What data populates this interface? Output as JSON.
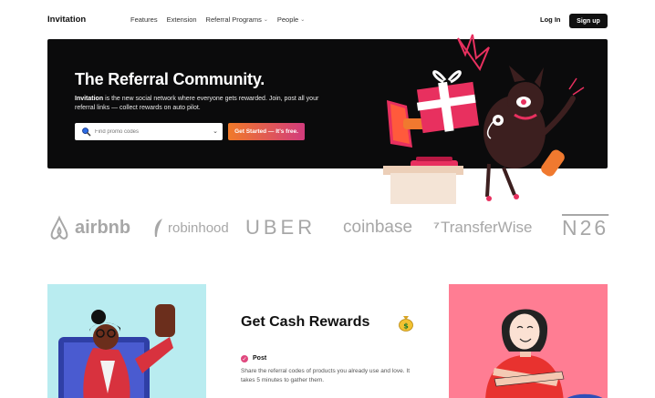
{
  "nav": {
    "brand": "Invitation",
    "links": [
      {
        "label": "Features",
        "dropdown": false
      },
      {
        "label": "Extension",
        "dropdown": false
      },
      {
        "label": "Referral Programs",
        "dropdown": true
      },
      {
        "label": "People",
        "dropdown": true
      }
    ],
    "login": "Log In",
    "signup": "Sign up"
  },
  "hero": {
    "title": "The Referral Community.",
    "desc_bold": "Invitation",
    "desc_rest": " is the new social network where everyone gets rewarded. Join, post all your referral links — collect rewards on auto pilot.",
    "search_placeholder": "Find promo codes",
    "cta": "Get Started — It's free.",
    "background": "#0b0b0c",
    "cta_gradient": [
      "#f07a2a",
      "#d23b7c"
    ]
  },
  "logos": [
    "airbnb",
    "robinhood",
    "UBER",
    "coinbase",
    "TransferWise",
    "N26"
  ],
  "rewards": {
    "title": "Get Cash Rewards",
    "icon": "money-bag-icon",
    "item_label": "Post",
    "item_desc": "Share the referral codes of products you already use and love. It takes 5 minutes to gather them."
  },
  "colors": {
    "card_left_bg": "#b9ecf0",
    "card_right_bg": "#ff7d93",
    "accent": "#e0487e",
    "logo_gray": "#a7a7a7"
  }
}
